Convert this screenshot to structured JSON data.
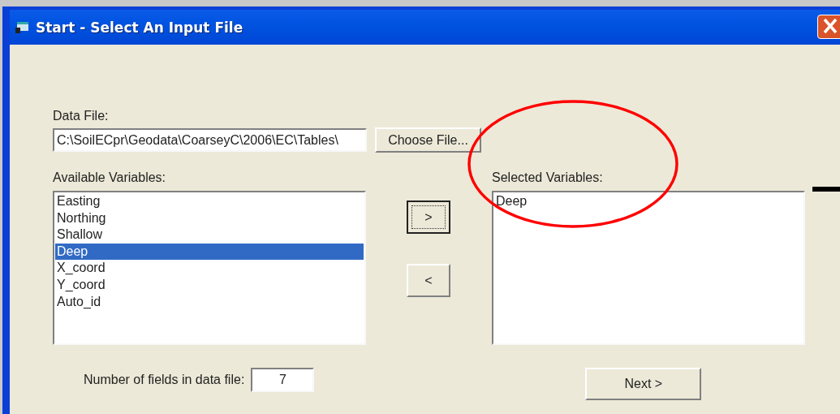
{
  "window": {
    "title": "Start - Select An Input File"
  },
  "data_file": {
    "label": "Data File:",
    "value": "C:\\SoilECpr\\Geodata\\CoarseyC\\2006\\EC\\Tables\\",
    "button": "Choose File..."
  },
  "available": {
    "label": "Available Variables:",
    "items": [
      {
        "label": "Easting",
        "selected": false
      },
      {
        "label": "Northing",
        "selected": false
      },
      {
        "label": "Shallow",
        "selected": false
      },
      {
        "label": "Deep",
        "selected": true
      },
      {
        "label": "X_coord",
        "selected": false
      },
      {
        "label": "Y_coord",
        "selected": false
      },
      {
        "label": "Auto_id",
        "selected": false
      }
    ]
  },
  "move_buttons": [
    {
      "label": ">",
      "focused": true
    },
    {
      "label": "<",
      "focused": false
    }
  ],
  "selected_vars": {
    "label": "Selected Variables:",
    "items": [
      {
        "label": "Deep",
        "selected": false
      }
    ]
  },
  "field_count": {
    "label": "Number of fields in data file:",
    "value": "7"
  },
  "next_button": "Next >"
}
